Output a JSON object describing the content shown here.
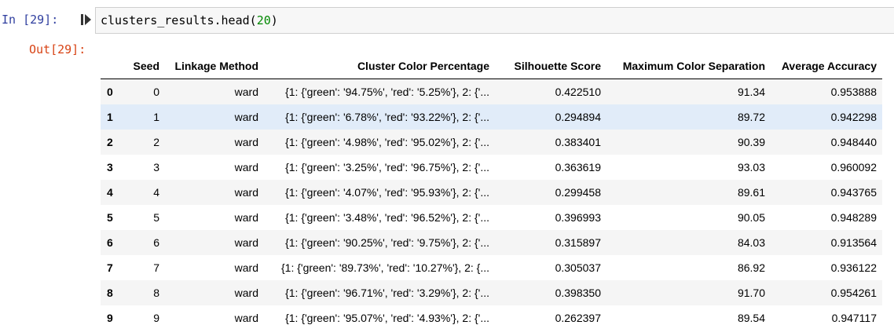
{
  "input_prompt": "In [29]:",
  "output_prompt": "Out[29]:",
  "code": {
    "prefix": "clusters_results.head(",
    "arg": "20",
    "suffix": ")"
  },
  "table": {
    "columns": [
      "Seed",
      "Linkage Method",
      "Cluster Color Percentage",
      "Silhouette Score",
      "Maximum Color Separation",
      "Average Accuracy"
    ],
    "rows": [
      {
        "index": "0",
        "seed": "0",
        "linkage": "ward",
        "ccp": "{1: {'green': '94.75%', 'red': '5.25%'}, 2: {'...",
        "sil": "0.422510",
        "mcs": "91.34",
        "acc": "0.953888"
      },
      {
        "index": "1",
        "seed": "1",
        "linkage": "ward",
        "ccp": "{1: {'green': '6.78%', 'red': '93.22%'}, 2: {'...",
        "sil": "0.294894",
        "mcs": "89.72",
        "acc": "0.942298"
      },
      {
        "index": "2",
        "seed": "2",
        "linkage": "ward",
        "ccp": "{1: {'green': '4.98%', 'red': '95.02%'}, 2: {'...",
        "sil": "0.383401",
        "mcs": "90.39",
        "acc": "0.948440"
      },
      {
        "index": "3",
        "seed": "3",
        "linkage": "ward",
        "ccp": "{1: {'green': '3.25%', 'red': '96.75%'}, 2: {'...",
        "sil": "0.363619",
        "mcs": "93.03",
        "acc": "0.960092"
      },
      {
        "index": "4",
        "seed": "4",
        "linkage": "ward",
        "ccp": "{1: {'green': '4.07%', 'red': '95.93%'}, 2: {'...",
        "sil": "0.299458",
        "mcs": "89.61",
        "acc": "0.943765"
      },
      {
        "index": "5",
        "seed": "5",
        "linkage": "ward",
        "ccp": "{1: {'green': '3.48%', 'red': '96.52%'}, 2: {'...",
        "sil": "0.396993",
        "mcs": "90.05",
        "acc": "0.948289"
      },
      {
        "index": "6",
        "seed": "6",
        "linkage": "ward",
        "ccp": "{1: {'green': '90.25%', 'red': '9.75%'}, 2: {'...",
        "sil": "0.315897",
        "mcs": "84.03",
        "acc": "0.913564"
      },
      {
        "index": "7",
        "seed": "7",
        "linkage": "ward",
        "ccp": "{1: {'green': '89.73%', 'red': '10.27%'}, 2: {...",
        "sil": "0.305037",
        "mcs": "86.92",
        "acc": "0.936122"
      },
      {
        "index": "8",
        "seed": "8",
        "linkage": "ward",
        "ccp": "{1: {'green': '96.71%', 'red': '3.29%'}, 2: {'...",
        "sil": "0.398350",
        "mcs": "91.70",
        "acc": "0.954261"
      },
      {
        "index": "9",
        "seed": "9",
        "linkage": "ward",
        "ccp": "{1: {'green': '95.07%', 'red': '4.93%'}, 2: {'...",
        "sil": "0.262397",
        "mcs": "89.54",
        "acc": "0.947117"
      }
    ],
    "hovered_row": 1
  },
  "icons": {
    "run": "run-cell-icon"
  },
  "colors": {
    "input_prompt": "#303f9f",
    "output_prompt": "#d84315",
    "code_number": "#008800",
    "row_hover": "#e1ecf9",
    "row_stripe": "#f5f5f5",
    "cell_background": "#f7f7f7"
  }
}
